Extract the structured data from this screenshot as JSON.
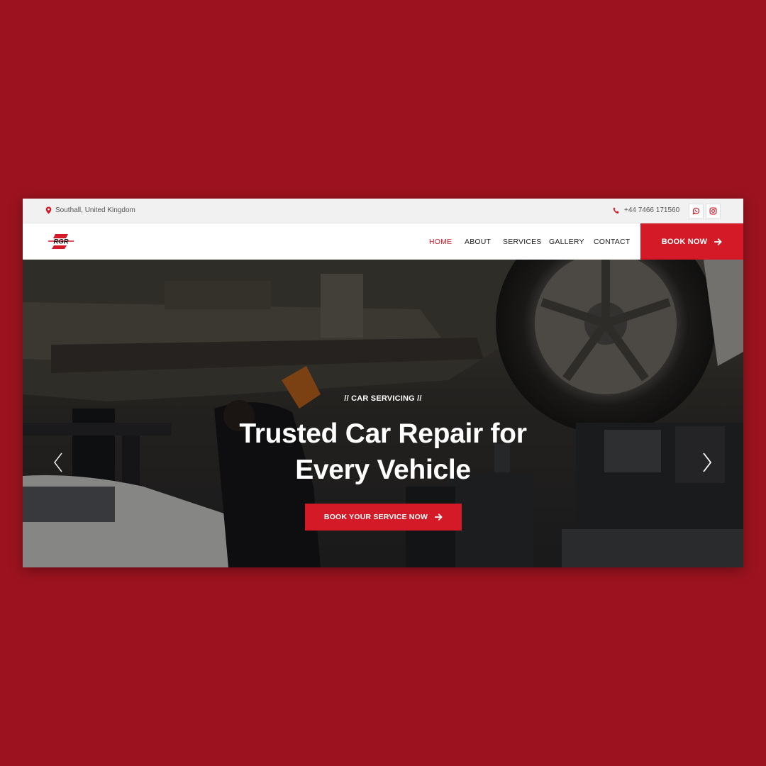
{
  "colors": {
    "page_background": "#9c131f",
    "accent": "#d31a26",
    "topbar_bg": "#f1f1f1"
  },
  "topbar": {
    "location_icon": "map-pin-icon",
    "location": "Southall, United Kingdom",
    "phone_icon": "phone-icon",
    "phone": "+44 7466 171560",
    "social": [
      {
        "icon": "whatsapp-icon"
      },
      {
        "icon": "instagram-icon"
      }
    ]
  },
  "nav": {
    "logo_text": "RGR",
    "items": [
      {
        "label": "HOME",
        "active": true
      },
      {
        "label": "ABOUT",
        "active": false
      },
      {
        "label": "SERVICES",
        "active": false
      },
      {
        "label": "GALLERY",
        "active": false
      },
      {
        "label": "CONTACT",
        "active": false
      }
    ],
    "cta_label": "BOOK NOW",
    "cta_icon": "arrow-right-icon"
  },
  "hero": {
    "kicker": "// CAR SERVICING //",
    "headline_line1": "Trusted Car Repair for",
    "headline_line2": "Every Vehicle",
    "button_label": "BOOK YOUR SERVICE NOW",
    "button_icon": "arrow-right-icon",
    "prev_icon": "chevron-left-icon",
    "next_icon": "chevron-right-icon"
  }
}
